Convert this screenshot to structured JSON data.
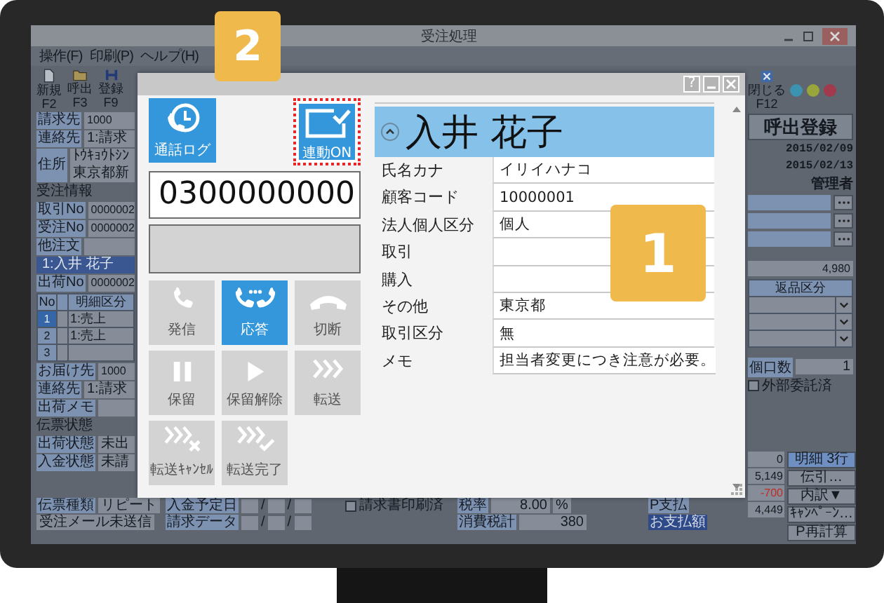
{
  "app": {
    "title": "受注処理",
    "menu": [
      "操作(F)",
      "印刷(P)",
      "ヘルプ(H)"
    ],
    "toolbar": [
      {
        "kind": "new",
        "label": "新規",
        "key": "F2"
      },
      {
        "kind": "open",
        "label": "呼出",
        "key": "F3"
      },
      {
        "kind": "save",
        "label": "登録",
        "key": "F9"
      },
      {
        "kind": "close",
        "label": "閉じる",
        "key": "F12"
      }
    ],
    "status_lights": [
      {
        "color": "#3c93b0"
      },
      {
        "color": "#98a53a"
      },
      {
        "color": "#a03a4c"
      }
    ],
    "left_panel": [
      {
        "kind": "field",
        "label": "請求先",
        "value": "1000"
      },
      {
        "kind": "field",
        "label": "連絡先",
        "value": "1:請求"
      },
      {
        "kind": "address",
        "label": "住所",
        "lines": [
          "ﾄｳｷｮｳﾄｼﾝ",
          "東京都新"
        ]
      },
      {
        "kind": "heading",
        "text": "受注情報"
      },
      {
        "kind": "field",
        "label": "取引No",
        "value": "0000002"
      },
      {
        "kind": "field",
        "label": "受注No",
        "value": "0000002"
      },
      {
        "kind": "field",
        "label": "他注文"
      },
      {
        "kind": "bar",
        "text": "1:入井 花子"
      },
      {
        "kind": "field",
        "label": "出荷No",
        "value": "0000002"
      },
      {
        "kind": "table",
        "columns": [
          "No",
          "明細区分"
        ],
        "rows": [
          {
            "no": "1",
            "value": "1:売上",
            "selected": true
          },
          {
            "no": "2",
            "value": "1:売上",
            "selected": false
          },
          {
            "no": "3",
            "selected": false
          }
        ]
      },
      {
        "kind": "field",
        "label": "お届け先",
        "value": "1000"
      },
      {
        "kind": "field",
        "label": "連絡先",
        "value": "1:請求"
      },
      {
        "kind": "field",
        "label": "出荷メモ"
      },
      {
        "kind": "heading",
        "text": "伝票状態"
      },
      {
        "kind": "field",
        "label": "出荷状態",
        "value": "未出"
      },
      {
        "kind": "field",
        "label": "入金状態",
        "value": "未請"
      }
    ],
    "bottom": {
      "slip_type": {
        "label": "伝票種類",
        "value": "リピート"
      },
      "mail_button": "受注メール未送信",
      "date_fields": [
        "入金予定日",
        "請求データ"
      ],
      "date_separator": "/",
      "invoice_printed": {
        "label": "請求書印刷済",
        "checked": false
      },
      "tax": {
        "label": "税率",
        "value": "8.00",
        "unit": "%"
      },
      "tax_total": {
        "label": "消費税計",
        "value": "380"
      },
      "point_label": "P支払",
      "payment_label": "お支払額"
    },
    "right_panel": {
      "form_title": "呼出登録",
      "dates": [
        "2015/02/09",
        "2015/02/13"
      ],
      "user": "管理者",
      "total": "4,980",
      "table_header": "返品区分",
      "parcel": {
        "label": "個口数",
        "value": "1"
      },
      "outsourced": {
        "label": "外部委託済",
        "checked": false
      },
      "amounts": [
        {
          "value": "0",
          "kind": "plain"
        },
        {
          "value": "5,149",
          "kind": "plain"
        },
        {
          "value": "-700",
          "kind": "negative"
        },
        {
          "value": "4,449",
          "kind": "plain"
        }
      ],
      "buttons": [
        {
          "label": "明細 3行",
          "kind": "info"
        },
        {
          "label": "伝引…",
          "kind": "button"
        },
        {
          "label": "内訳▼",
          "kind": "button"
        },
        {
          "label": "ｷｬﾝﾍﾟｰﾝ…",
          "kind": "button"
        },
        {
          "label": "P再計算",
          "kind": "button"
        }
      ]
    }
  },
  "popup": {
    "help_button": "?",
    "top_buttons": [
      {
        "kind": "log",
        "label": "通話ログ",
        "highlighted": false
      },
      {
        "kind": "link",
        "label": "連動ON",
        "highlighted": true
      }
    ],
    "phone_number": "0300000000",
    "call_buttons": [
      {
        "kind": "dial",
        "label": "発信",
        "active": false
      },
      {
        "kind": "answer",
        "label": "応答",
        "active": true
      },
      {
        "kind": "hangup",
        "label": "切断",
        "active": false
      },
      {
        "kind": "hold",
        "label": "保留",
        "active": false
      },
      {
        "kind": "unhold",
        "label": "保留解除",
        "active": false
      },
      {
        "kind": "transfer",
        "label": "転送",
        "active": false
      },
      {
        "kind": "transfer_cancel",
        "label": "転送ｷｬﾝｾﾙ",
        "active": false
      },
      {
        "kind": "transfer_complete",
        "label": "転送完了",
        "active": false
      }
    ],
    "customer": {
      "name": "入井 花子",
      "expanded": true,
      "fields": [
        {
          "label": "氏名カナ",
          "value": "イリイハナコ"
        },
        {
          "label": "顧客コード",
          "value": "10000001"
        },
        {
          "label": "法人個人区分",
          "value": "個人"
        },
        {
          "label": "取引"
        },
        {
          "label": "購入"
        },
        {
          "label": "その他",
          "value": "東京都"
        },
        {
          "label": "取引区分",
          "value": "無"
        },
        {
          "label": "メモ",
          "value": "担当者変更につき注意が必要。"
        }
      ]
    }
  },
  "badges": [
    "2",
    "1"
  ]
}
